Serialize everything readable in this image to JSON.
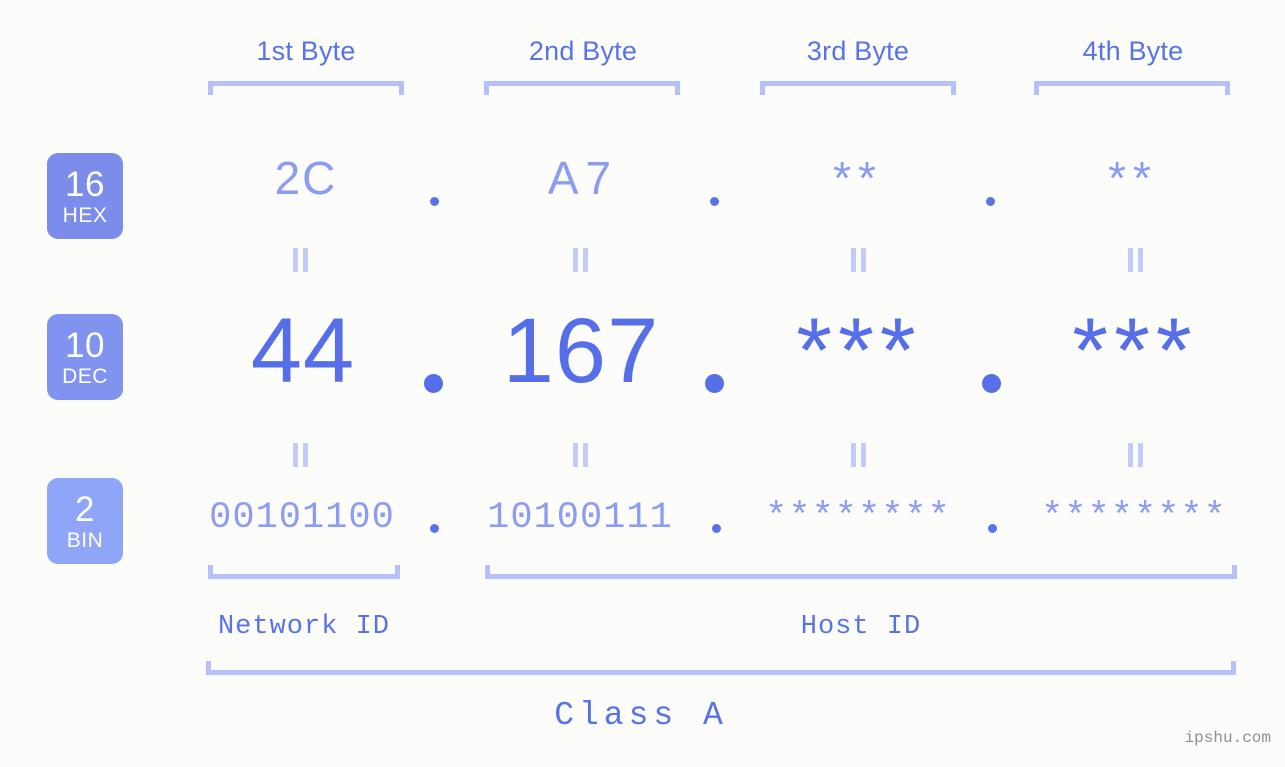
{
  "meta": {
    "background_color": "#fcfdfa",
    "accent_color": "#566ee8",
    "light_accent_color": "#8b9cf2",
    "bracket_color": "#b6c0fb",
    "watermark": "ipshu.com"
  },
  "byte_headers": [
    {
      "label": "1st Byte"
    },
    {
      "label": "2nd Byte"
    },
    {
      "label": "3rd Byte"
    },
    {
      "label": "4th Byte"
    }
  ],
  "bases": [
    {
      "number": "16",
      "name": "HEX",
      "color": "#7b8ceb"
    },
    {
      "number": "10",
      "name": "DEC",
      "color": "#8094ef"
    },
    {
      "number": "2",
      "name": "BIN",
      "color": "#8fa6f8"
    }
  ],
  "rows": {
    "hex": {
      "values": [
        "2C",
        "A7",
        "**",
        "**"
      ],
      "separator": "."
    },
    "dec": {
      "values": [
        "44",
        "167",
        "***",
        "***"
      ],
      "separator": "."
    },
    "bin": {
      "values": [
        "00101100",
        "10100111",
        "********",
        "********"
      ],
      "separator": "."
    }
  },
  "connectors": {
    "symbol": "||"
  },
  "segments": [
    {
      "label": "Network ID"
    },
    {
      "label": "Host ID"
    }
  ],
  "class": {
    "label": "Class A"
  },
  "chart_data": {
    "type": "table",
    "title": "IP address byte breakdown",
    "columns": [
      "1st Byte",
      "2nd Byte",
      "3rd Byte",
      "4th Byte"
    ],
    "rows": [
      {
        "base": "16 HEX",
        "values": [
          "2C",
          "A7",
          "**",
          "**"
        ]
      },
      {
        "base": "10 DEC",
        "values": [
          "44",
          "167",
          "***",
          "***"
        ]
      },
      {
        "base": "2 BIN",
        "values": [
          "00101100",
          "10100111",
          "********",
          "********"
        ]
      }
    ],
    "network_id_bytes": 1,
    "host_id_bytes": 3,
    "address_class": "Class A"
  }
}
